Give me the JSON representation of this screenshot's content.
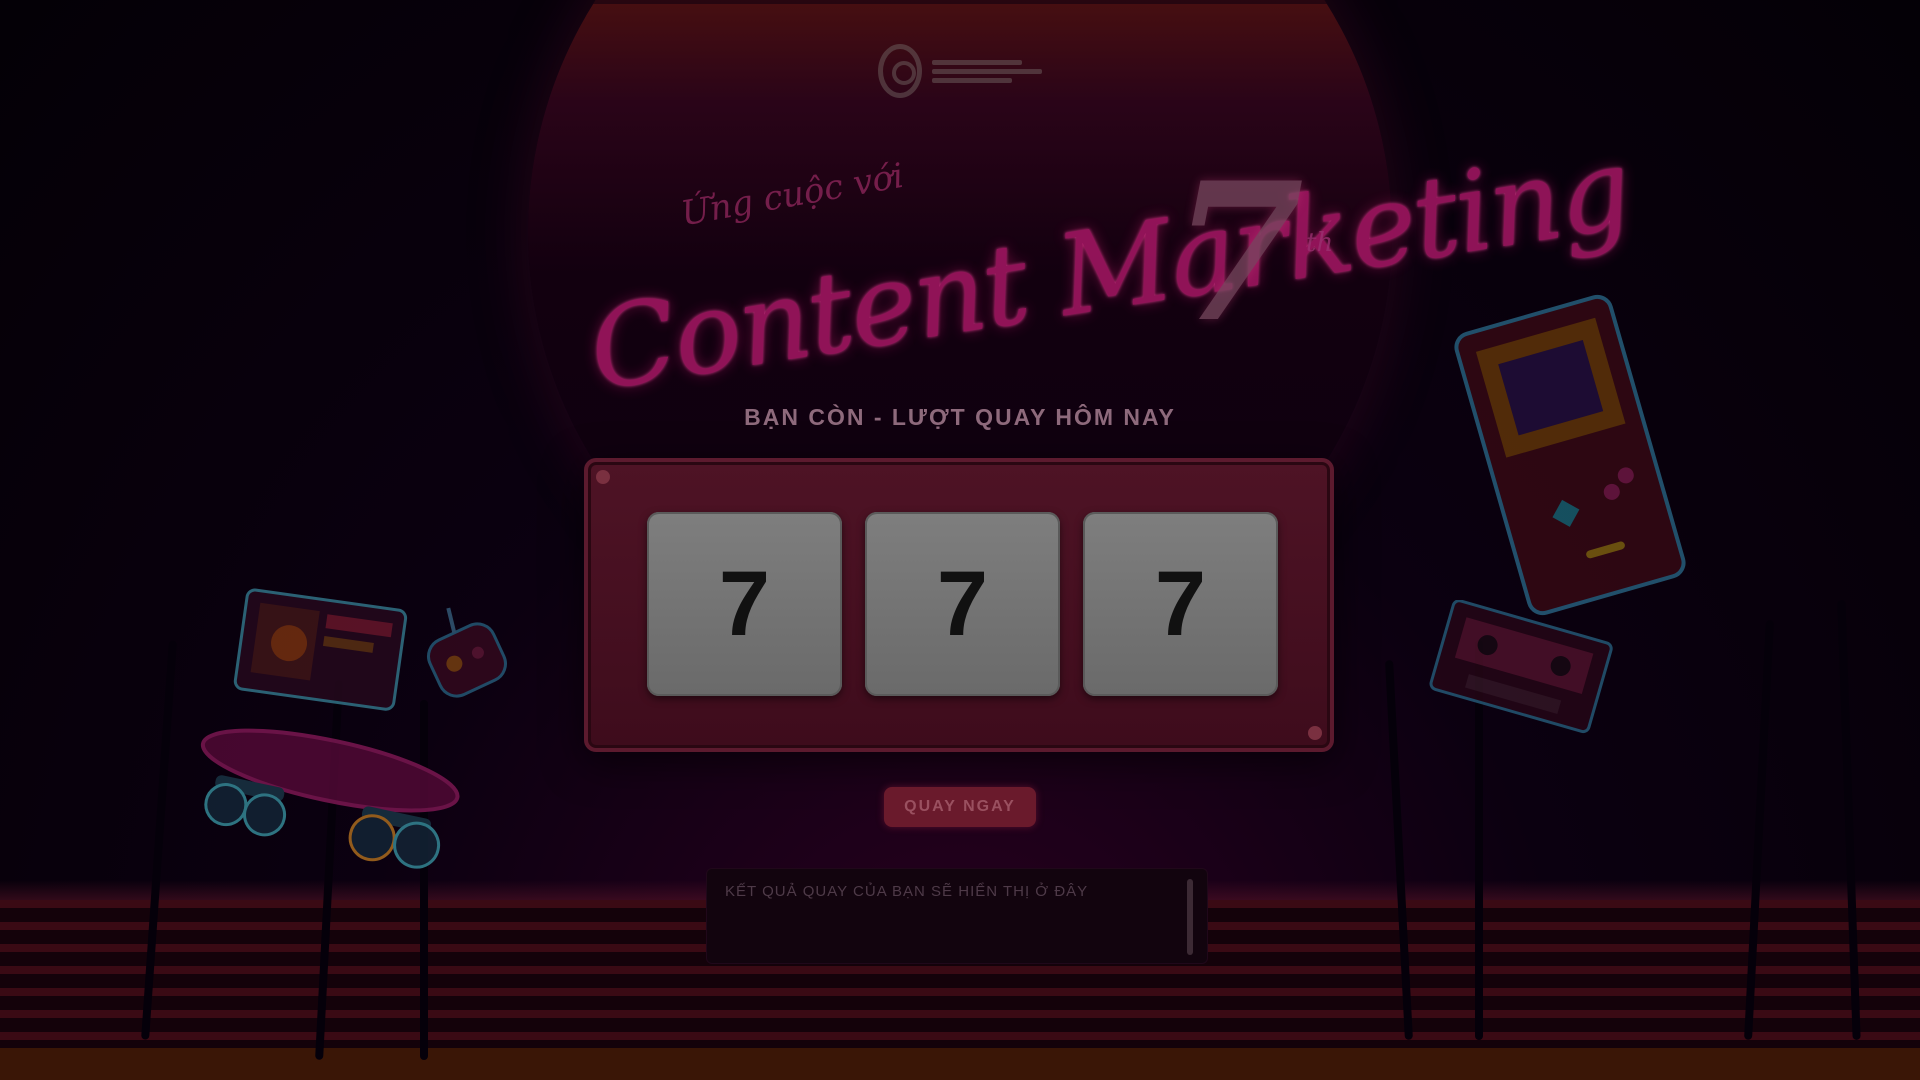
{
  "page": {
    "title_small": "Ứng cuộc với",
    "title_main": "Content Marketing",
    "title_number": "7",
    "title_suffix": "th",
    "spins_text": "BẠN CÒN - LƯỢT QUAY HÔM NAY"
  },
  "slot_machine": {
    "reels": [
      "7",
      "7",
      "7"
    ]
  },
  "spin_button": {
    "label": "QUAY NGAY"
  },
  "result_box": {
    "text": "KẾT QUẢ QUAY CỦA BẠN SẼ HIỂN THỊ Ở ĐÂY"
  },
  "colors": {
    "accent": "#b0186a",
    "machine": "#4e1325",
    "reel": "#7e7e7e",
    "background": "#050006"
  },
  "icons": [
    "logo-icon",
    "skateboard-icon",
    "gameboy-icon",
    "cassette-icon",
    "photo-card-icon",
    "game-controller-icon"
  ]
}
